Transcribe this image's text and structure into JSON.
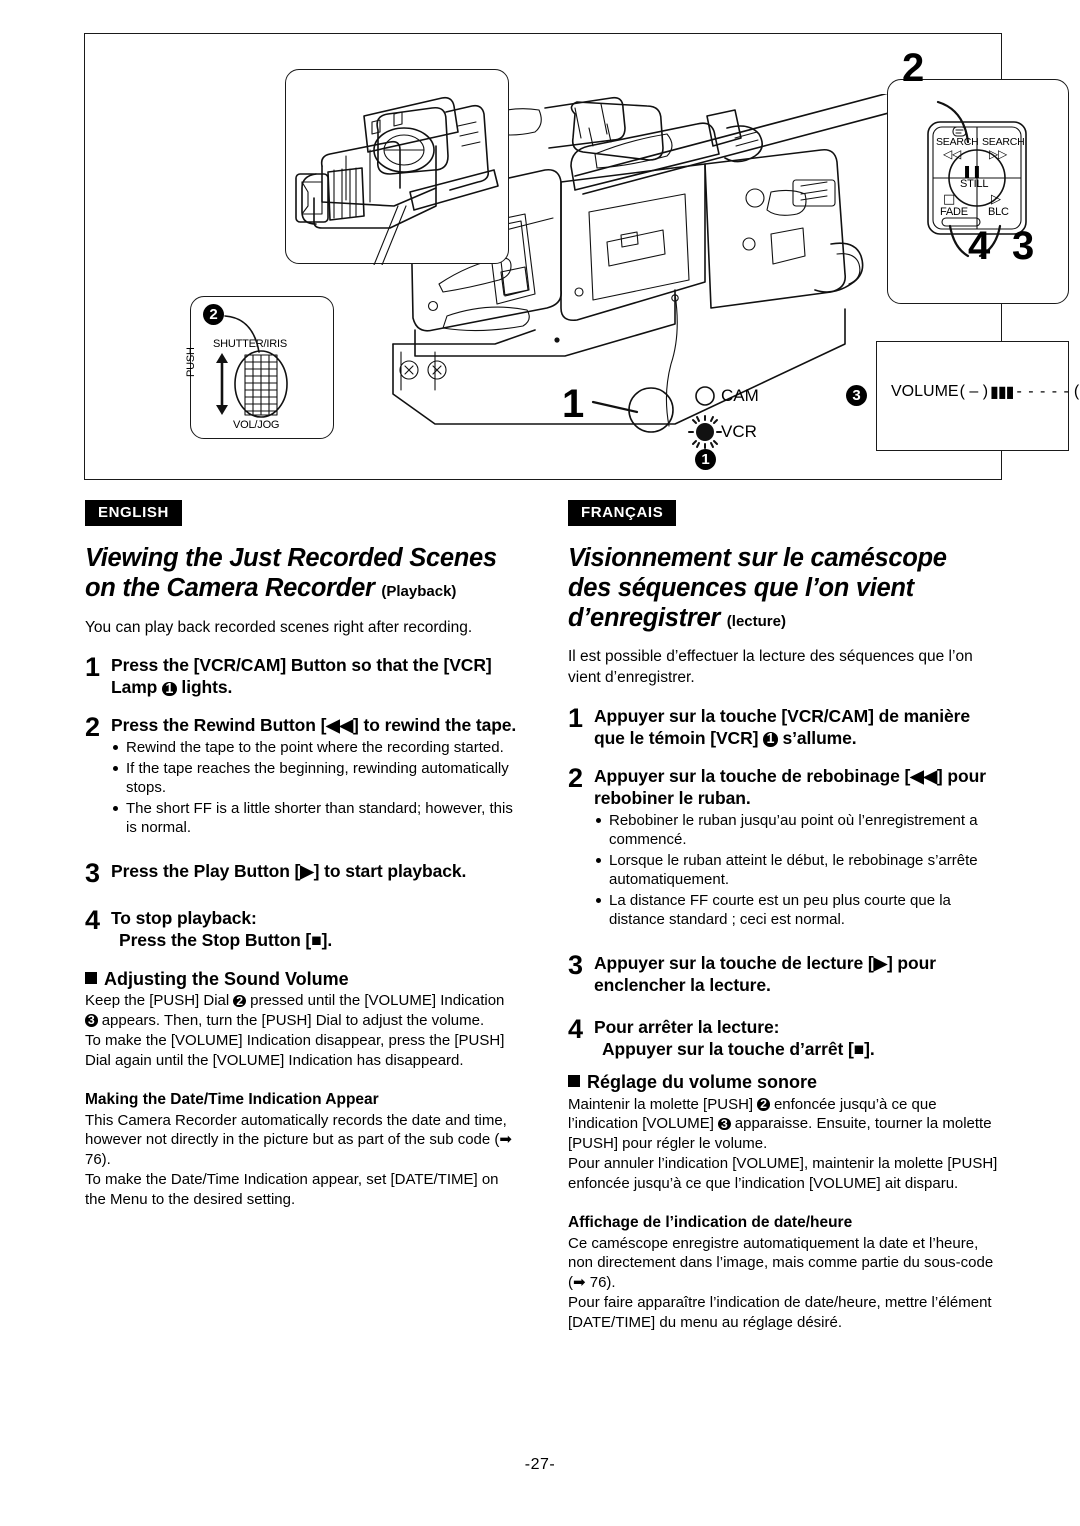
{
  "illustration": {
    "callouts": {
      "one": "1",
      "two": "2",
      "three": "3",
      "four": "4"
    },
    "circled": {
      "one": "1",
      "two": "2",
      "three": "3"
    },
    "dial_panel": {
      "top_label": "SHUTTER/IRIS",
      "side_label": "PUSH",
      "bottom_label": "VOL/JOG"
    },
    "control_pad": {
      "search_rev_label": "SEARCH",
      "search_rev_glyph": "◁◁",
      "search_fwd_label": "SEARCH",
      "search_fwd_glyph": "▷▷",
      "still_label": "STILL",
      "still_glyph": "❚❚",
      "fade_label": "FADE",
      "fade_glyph": "□",
      "blc_label": "BLC",
      "blc_glyph": "▷"
    },
    "lamps": {
      "cam_label": "CAM",
      "vcr_label": "VCR"
    },
    "volume_indication": {
      "label": "VOLUME",
      "minus": "( – )",
      "bars": "▮▮▮",
      "dashes": "- - - - -",
      "plus": "( + )"
    }
  },
  "english": {
    "lang_tag": "ENGLISH",
    "title_line1": "Viewing the Just Recorded Scenes",
    "title_line2": "on the Camera Recorder",
    "title_sub": "(Playback)",
    "intro": "You can play back recorded scenes right after recording.",
    "steps": [
      {
        "num": "1",
        "title": "Press the [VCR/CAM] Button so that the [VCR] Lamp ❶ lights.",
        "title_pre": "Press the [VCR/CAM] Button so that the [VCR] Lamp ",
        "title_post": " lights.",
        "bullets": []
      },
      {
        "num": "2",
        "title_pre": "Press the Rewind Button [◀◀] to rewind the tape.",
        "bullets": [
          "Rewind the tape to the point where the recording started.",
          "If the tape reaches the beginning, rewinding automatically stops.",
          "The short FF is a little shorter than standard; however, this is normal."
        ]
      },
      {
        "num": "3",
        "title_pre": "Press the Play Button [▶] to start playback.",
        "bullets": []
      },
      {
        "num": "4",
        "title_pre": "To stop playback:",
        "title_line2": "Press the Stop Button [■].",
        "bullets": []
      }
    ],
    "volume_head": "Adjusting the Sound Volume",
    "volume_body_1_pre": "Keep the [PUSH] Dial ",
    "volume_body_1_mid": " pressed until the [VOLUME] Indication ",
    "volume_body_1_post": " appears. Then, turn the [PUSH] Dial to adjust the volume.",
    "volume_body_2": "To make the [VOLUME] Indication disappear, press the [PUSH] Dial again until the [VOLUME] Indication has disappeard.",
    "datetime_head": "Making the Date/Time Indication Appear",
    "datetime_body_1": "This Camera Recorder automatically records the date and time, however not directly in the picture but as part of the sub code (➡ 76).",
    "datetime_body_2": "To make the Date/Time Indication appear, set [DATE/TIME] on the Menu to the desired setting."
  },
  "francais": {
    "lang_tag": "FRANÇAIS",
    "title_line1": "Visionnement sur le caméscope",
    "title_line2": "des séquences que l’on vient",
    "title_line3": "d’enregistrer",
    "title_sub": "(lecture)",
    "intro": "Il est possible d’effectuer la lecture des séquences que l’on vient d’enregistrer.",
    "steps": [
      {
        "num": "1",
        "title_pre": "Appuyer sur la touche [VCR/CAM] de manière que le témoin [VCR] ",
        "title_post": " s’allume.",
        "bullets": []
      },
      {
        "num": "2",
        "title_pre": "Appuyer sur la touche de rebobinage [◀◀] pour rebobiner le ruban.",
        "bullets": [
          "Rebobiner le ruban jusqu’au point où l’enregistrement a commencé.",
          "Lorsque le ruban atteint le début, le rebobinage s’arrête automatiquement.",
          "La distance FF courte est un peu plus courte que la distance standard ; ceci est normal."
        ]
      },
      {
        "num": "3",
        "title_pre": "Appuyer sur la touche de lecture [▶] pour enclencher la lecture.",
        "bullets": []
      },
      {
        "num": "4",
        "title_pre": "Pour arrêter la lecture:",
        "title_line2": "Appuyer sur la touche d’arrêt [■].",
        "bullets": []
      }
    ],
    "volume_head": "Réglage du volume sonore",
    "volume_body_1_pre": "Maintenir la molette [PUSH] ",
    "volume_body_1_mid": " enfoncée jusqu’à ce que l’indication [VOLUME] ",
    "volume_body_1_post": " apparaisse. Ensuite, tourner la molette [PUSH] pour régler le volume.",
    "volume_body_2": "Pour annuler l’indication [VOLUME], maintenir la molette [PUSH] enfoncée jusqu’à ce que l’indication [VOLUME] ait disparu.",
    "datetime_head": "Affichage de l’indication de date/heure",
    "datetime_body_1": "Ce caméscope enregistre automatiquement la date et l’heure, non directement dans l’image, mais comme partie du sous-code (➡ 76).",
    "datetime_body_2": "Pour faire apparaître l’indication de date/heure, mettre l’élément [DATE/TIME] du menu au réglage désiré."
  },
  "footer": {
    "page_number": "-27-"
  }
}
